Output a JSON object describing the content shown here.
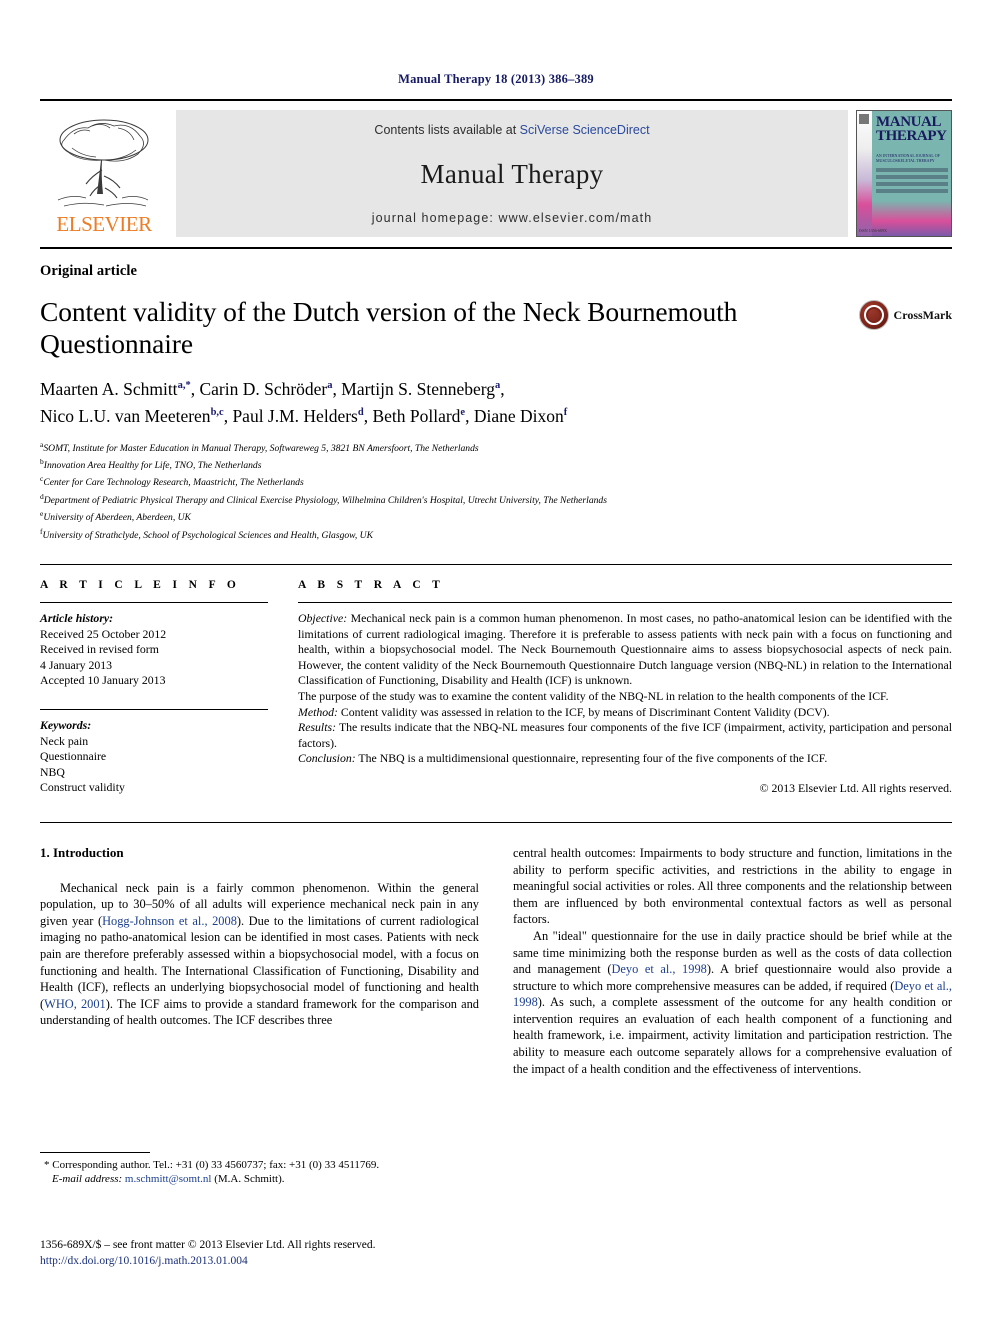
{
  "running_head": "Manual Therapy 18 (2013) 386–389",
  "masthead": {
    "contents_prefix": "Contents lists available at ",
    "sciencedirect": "SciVerse ScienceDirect",
    "journal_title": "Manual Therapy",
    "homepage": "journal homepage: www.elsevier.com/math",
    "publisher_logo_text": "ELSEVIER",
    "cover": {
      "title_line1": "MANUAL",
      "title_line2": "THERAPY",
      "subtitle": "AN INTERNATIONAL JOURNAL OF MUSCULOSKELETAL THERAPY",
      "footer": "ISSN 1356-689X"
    }
  },
  "article": {
    "type_label": "Original article",
    "title": "Content validity of the Dutch version of the Neck Bournemouth Questionnaire",
    "crossmark_label": "CrossMark",
    "authors_line1": "Maarten A. Schmitt",
    "authors_sup1": "a,*",
    "authors_line1b": ", Carin D. Schröder",
    "authors_sup1b": "a",
    "authors_line1c": ", Martijn S. Stenneberg",
    "authors_sup1c": "a",
    "authors_line1d": ",",
    "authors_line2": "Nico L.U. van Meeteren",
    "authors_sup2": "b,c",
    "authors_line2b": ", Paul J.M. Helders",
    "authors_sup2b": "d",
    "authors_line2c": ", Beth Pollard",
    "authors_sup2c": "e",
    "authors_line2d": ", Diane Dixon",
    "authors_sup2d": "f",
    "affiliations": [
      {
        "marker": "a",
        "text": "SOMT, Institute for Master Education in Manual Therapy, Softwareweg 5, 3821 BN Amersfoort, The Netherlands"
      },
      {
        "marker": "b",
        "text": "Innovation Area Healthy for Life, TNO, The Netherlands"
      },
      {
        "marker": "c",
        "text": "Center for Care Technology Research, Maastricht, The Netherlands"
      },
      {
        "marker": "d",
        "text": "Department of Pediatric Physical Therapy and Clinical Exercise Physiology, Wilhelmina Children's Hospital, Utrecht University, The Netherlands"
      },
      {
        "marker": "e",
        "text": "University of Aberdeen, Aberdeen, UK"
      },
      {
        "marker": "f",
        "text": "University of Strathclyde, School of Psychological Sciences and Health, Glasgow, UK"
      }
    ]
  },
  "article_info": {
    "heading": "A R T I C L E  I N F O",
    "history_label": "Article history:",
    "history": [
      "Received 25 October 2012",
      "Received in revised form",
      "4 January 2013",
      "Accepted 10 January 2013"
    ],
    "keywords_label": "Keywords:",
    "keywords": [
      "Neck pain",
      "Questionnaire",
      "NBQ",
      "Construct validity"
    ]
  },
  "abstract": {
    "heading": "A B S T R A C T",
    "objective_label": "Objective:",
    "objective_text": " Mechanical neck pain is a common human phenomenon. In most cases, no patho-anatomical lesion can be identified with the limitations of current radiological imaging. Therefore it is preferable to assess patients with neck pain with a focus on functioning and health, within a biopsychosocial model. The Neck Bournemouth Questionnaire aims to assess biopsychosocial aspects of neck pain. However, the content validity of the Neck Bournemouth Questionnaire Dutch language version (NBQ-NL) in relation to the International Classification of Functioning, Disability and Health (ICF) is unknown.",
    "purpose_text": "The purpose of the study was to examine the content validity of the NBQ-NL in relation to the health components of the ICF.",
    "method_label": "Method:",
    "method_text": " Content validity was assessed in relation to the ICF, by means of Discriminant Content Validity (DCV).",
    "results_label": "Results:",
    "results_text": " The results indicate that the NBQ-NL measures four components of the five ICF (impairment, activity, participation and personal factors).",
    "conclusion_label": "Conclusion:",
    "conclusion_text": " The NBQ is a multidimensional questionnaire, representing four of the five components of the ICF.",
    "copyright": "© 2013 Elsevier Ltd. All rights reserved."
  },
  "introduction": {
    "heading": "1. Introduction",
    "left_p1_a": "Mechanical neck pain is a fairly common phenomenon. Within the general population, up to 30–50% of all adults will experience mechanical neck pain in any given year (",
    "left_ref1": "Hogg-Johnson et al., 2008",
    "left_p1_b": "). Due to the limitations of current radiological imaging no patho-anatomical lesion can be identified in most cases. Patients with neck pain are therefore preferably assessed within a biopsychosocial model, with a focus on functioning and health. The International Classification of Functioning, Disability and Health (ICF), reflects an underlying biopsychosocial model of functioning and health (",
    "left_ref2": "WHO, 2001",
    "left_p1_c": "). The ICF aims to provide a standard framework for the comparison and understanding of health outcomes. The ICF describes three",
    "right_p1_cont": "central health outcomes: Impairments to body structure and function, limitations in the ability to perform specific activities, and restrictions in the ability to engage in meaningful social activities or roles. All three components and the relationship between them are influenced by both environmental contextual factors as well as personal factors.",
    "right_p2_a": "An \"ideal\" questionnaire for the use in daily practice should be brief while at the same time minimizing both the response burden as well as the costs of data collection and management (",
    "right_ref1": "Deyo et al., 1998",
    "right_p2_b": "). A brief questionnaire would also provide a structure to which more comprehensive measures can be added, if required (",
    "right_ref2": "Deyo et al., 1998",
    "right_p2_c": "). As such, a complete assessment of the outcome for any health condition or intervention requires an evaluation of each health component of a functioning and health framework, i.e. impairment, activity limitation and participation restriction. The ability to measure each outcome separately allows for a comprehensive evaluation of the impact of a health condition and the effectiveness of interventions."
  },
  "footnotes": {
    "corresponding": "* Corresponding author. Tel.: +31 (0) 33 4560737; fax: +31 (0) 33 4511769.",
    "email_label": "E-mail address:",
    "email": "m.schmitt@somt.nl",
    "email_suffix": " (M.A. Schmitt).",
    "issn_line": "1356-689X/$ – see front matter © 2013 Elsevier Ltd. All rights reserved.",
    "doi": "http://dx.doi.org/10.1016/j.math.2013.01.004"
  }
}
